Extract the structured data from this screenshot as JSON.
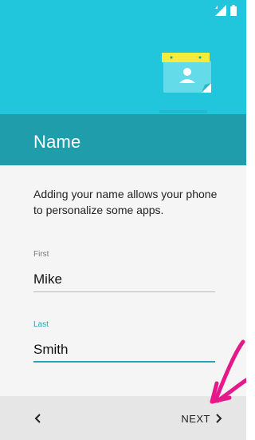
{
  "screen": {
    "title": "Name",
    "description": "Adding your name allows your phone to personalize some apps."
  },
  "fields": {
    "first": {
      "label": "First",
      "value": "Mike"
    },
    "last": {
      "label": "Last",
      "value": "Smith"
    }
  },
  "nav": {
    "back_icon": "chevron-left-icon",
    "next_label": "NEXT",
    "next_icon": "chevron-right-icon"
  },
  "colors": {
    "hero": "#21c6dc",
    "title_band": "#1f9dab",
    "accent": "#21a7b6",
    "annotation": "#e6198a"
  }
}
